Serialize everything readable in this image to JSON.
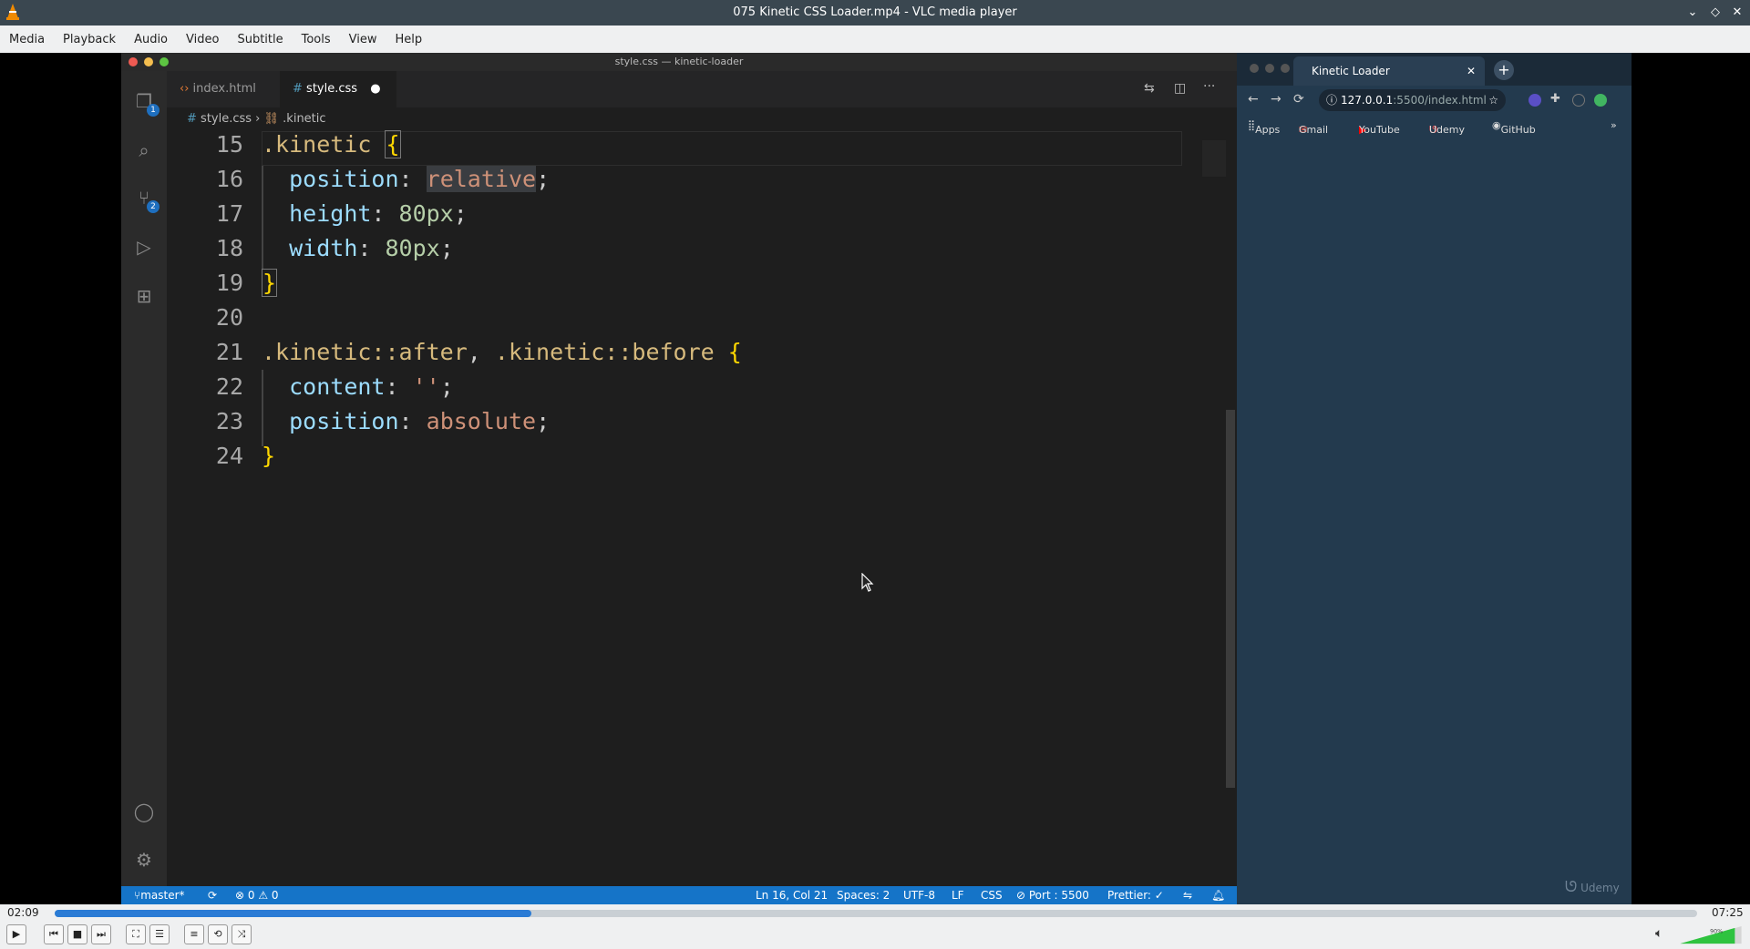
{
  "window": {
    "title": "075 Kinetic CSS Loader.mp4 - VLC media player"
  },
  "menu": [
    "Media",
    "Playback",
    "Audio",
    "Video",
    "Subtitle",
    "Tools",
    "View",
    "Help"
  ],
  "vscode": {
    "title": "style.css — kinetic-loader",
    "tabs": [
      {
        "label": "index.html",
        "active": false
      },
      {
        "label": "style.css",
        "active": true,
        "dirty": true
      }
    ],
    "breadcrumb": {
      "file": "style.css",
      "symbol": ".kinetic"
    },
    "badges": {
      "explorer": "1",
      "scm": "2"
    },
    "lines": [
      {
        "n": "15",
        "text": ".kinetic {"
      },
      {
        "n": "16",
        "text": "  position: relative;"
      },
      {
        "n": "17",
        "text": "  height: 80px;"
      },
      {
        "n": "18",
        "text": "  width: 80px;"
      },
      {
        "n": "19",
        "text": "}"
      },
      {
        "n": "20",
        "text": ""
      },
      {
        "n": "21",
        "text": ".kinetic::after, .kinetic::before {"
      },
      {
        "n": "22",
        "text": "  content: '';"
      },
      {
        "n": "23",
        "text": "  position: absolute;"
      },
      {
        "n": "24",
        "text": "}"
      }
    ],
    "status": {
      "branch": "master*",
      "problems": "⊗ 0 ⚠ 0",
      "position": "Ln 16, Col 21",
      "spaces": "Spaces: 2",
      "encoding": "UTF-8",
      "eol": "LF",
      "language": "CSS",
      "port": "⊘ Port : 5500",
      "prettier": "Prettier: ✓"
    }
  },
  "browser": {
    "tab": "Kinetic Loader",
    "url_host": "127.0.0.1",
    "url_path": ":5500/index.html",
    "bookmarks": [
      "Apps",
      "Gmail",
      "YouTube",
      "Udemy",
      "GitHub"
    ],
    "watermark": "Udemy"
  },
  "player": {
    "elapsed": "02:09",
    "total": "07:25",
    "progress": 0.29,
    "volume": "90%"
  }
}
